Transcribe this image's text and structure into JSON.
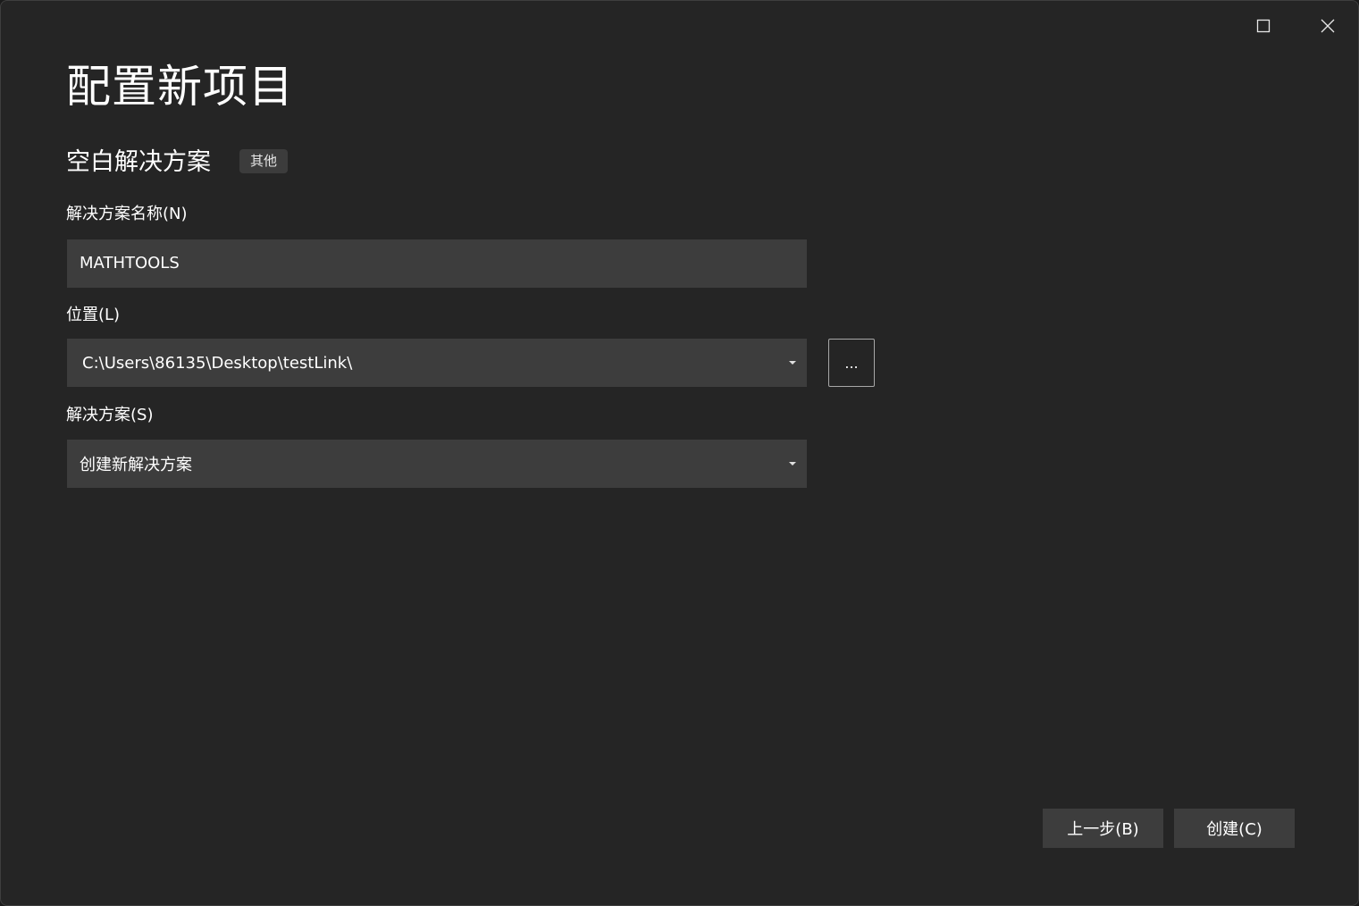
{
  "window": {
    "maximize_icon": "maximize-icon",
    "close_icon": "close-icon"
  },
  "header": {
    "title": "配置新项目",
    "template_name": "空白解决方案",
    "tag": "其他"
  },
  "form": {
    "solution_name": {
      "label": "解决方案名称(N)",
      "value": "MATHTOOLS"
    },
    "location": {
      "label": "位置(L)",
      "value": "C:\\Users\\86135\\Desktop\\testLink\\",
      "browse_label": "..."
    },
    "solution": {
      "label": "解决方案(S)",
      "value": "创建新解决方案"
    }
  },
  "footer": {
    "back_label": "上一步(B)",
    "create_label": "创建(C)"
  },
  "colors": {
    "background": "#252525",
    "field": "#3d3d3d",
    "text": "#ffffff"
  }
}
